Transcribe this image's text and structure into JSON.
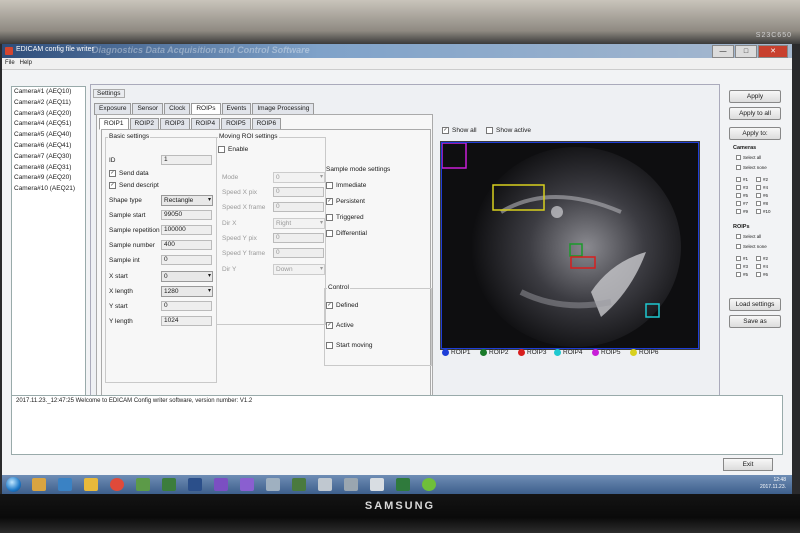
{
  "window": {
    "title": "EDICAM config file writer",
    "subtitle_bg": "Diagnostics Data Acquisition and Control Software",
    "buttons": [
      "—",
      "□",
      "✕"
    ]
  },
  "menu": [
    "File",
    "Help"
  ],
  "cameras": [
    "Camera#1 (AEQ10)",
    "Camera#2 (AEQ11)",
    "Camera#3 (AEQ20)",
    "Camera#4 (AEQ51)",
    "Camera#5 (AEQ40)",
    "Camera#6 (AEQ41)",
    "Camera#7 (AEQ30)",
    "Camera#8 (AEQ31)",
    "Camera#9 (AEQ20)",
    "Camera#10 (AEQ21)"
  ],
  "settings_label": "Settings",
  "tabs": [
    "Exposure",
    "Sensor",
    "Clock",
    "ROIPs",
    "Events",
    "Image Processing"
  ],
  "roip_tabs": [
    "ROIP1",
    "ROIP2",
    "ROIP3",
    "ROIP4",
    "ROIP5",
    "ROIP6"
  ],
  "basic": {
    "title": "Basic settings",
    "id_label": "ID",
    "id_value": "1",
    "send_data": "Send data",
    "send_descript": "Send descript",
    "shape_label": "Shape type",
    "shape_value": "Rectangle",
    "sample_start_label": "Sample start",
    "sample_start": "99050",
    "sample_rep_label": "Sample repetition",
    "sample_rep": "100000",
    "sample_num_label": "Sample number",
    "sample_num": "400",
    "sample_int_label": "Sample int",
    "sample_int": "0",
    "xstart_label": "X start",
    "xstart": "0",
    "xlength_label": "X length",
    "xlength": "1280",
    "ystart_label": "Y start",
    "ystart": "0",
    "ylength_label": "Y length",
    "ylength": "1024"
  },
  "moving": {
    "title": "Moving ROI settings",
    "enable": "Enable",
    "mode_label": "Mode",
    "mode": "0",
    "speedxpix_label": "Speed X pix",
    "speedxpix": "0",
    "speedxframe_label": "Speed X frame",
    "speedxframe": "0",
    "dirx_label": "Dir X",
    "dirx": "Right",
    "speedypix_label": "Speed Y pix",
    "speedypix": "0",
    "speedyframe_label": "Speed Y frame",
    "speedyframe": "0",
    "diry_label": "Dir Y",
    "diry": "Down"
  },
  "sample_mode": {
    "title": "Sample mode settings",
    "immediate": "Immediate",
    "persistent": "Persistent",
    "triggered": "Triggered",
    "differential": "Differential"
  },
  "control": {
    "title": "Control",
    "defined": "Defined",
    "active": "Active",
    "start_moving": "Start moving"
  },
  "view": {
    "show_all": "Show all",
    "show_active": "Show active"
  },
  "legend": [
    {
      "name": "ROIP1",
      "color": "#1e3ed8"
    },
    {
      "name": "ROIP2",
      "color": "#1a7a2a"
    },
    {
      "name": "ROIP3",
      "color": "#d81e1e"
    },
    {
      "name": "ROIP4",
      "color": "#1ec8d0"
    },
    {
      "name": "ROIP5",
      "color": "#c81ed8"
    },
    {
      "name": "ROIP6",
      "color": "#d8d01e"
    }
  ],
  "right": {
    "apply": "Apply",
    "apply_all": "Apply to all",
    "apply_to": "Apply to:",
    "cameras_title": "Cameras",
    "select_all": "Select all",
    "select_none": "Select none",
    "cam_checks": [
      "#1",
      "#2",
      "#3",
      "#4",
      "#5",
      "#6",
      "#7",
      "#8",
      "#9",
      "#10"
    ],
    "roips_title": "ROIPs",
    "roip_checks": [
      "#1",
      "#2",
      "#3",
      "#4",
      "#5",
      "#6"
    ],
    "load": "Load settings",
    "save": "Save as"
  },
  "log": "2017.11.23._12:47:25 Welcome to EDICAM Config writer software, version number: V1.2",
  "exit": "Exit",
  "clock": {
    "time": "12:48",
    "date": "2017.11.23."
  },
  "brand": "SAMSUNG",
  "brand_top": "S23C650"
}
